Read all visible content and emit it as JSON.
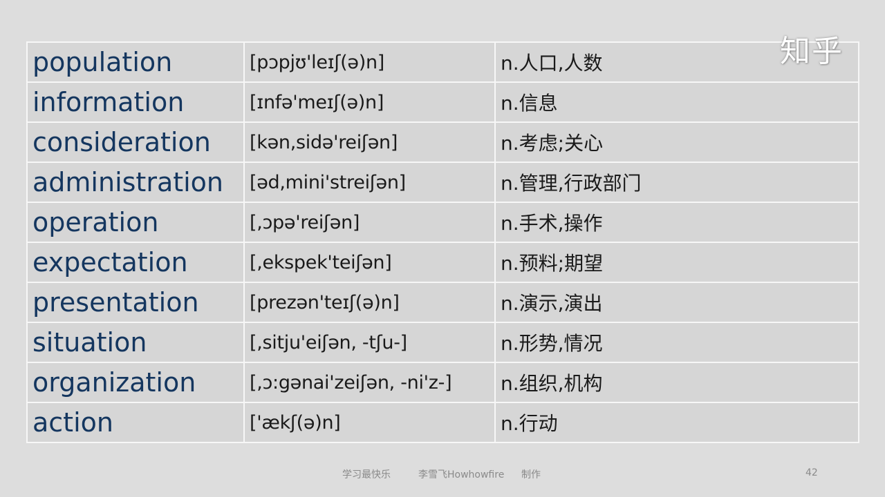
{
  "watermark": "知乎",
  "rows": [
    {
      "word": "population",
      "phonetic": "[pɔpjʊ'leɪʃ(ə)n]",
      "definition": "n.人口,人数"
    },
    {
      "word": "information",
      "phonetic": "[ɪnfə'meɪʃ(ə)n]",
      "definition": "n.信息"
    },
    {
      "word": "consideration",
      "phonetic": "[kən,sidə'reiʃən]",
      "definition": "n.考虑;关心"
    },
    {
      "word": "administration",
      "phonetic": "[əd,mini'streiʃən]",
      "definition": "n.管理,行政部门"
    },
    {
      "word": "operation",
      "phonetic": "[,ɔpə'reiʃən]",
      "definition": "n.手术,操作"
    },
    {
      "word": "expectation",
      "phonetic": "[,ekspek'teiʃən]",
      "definition": "n.预料;期望"
    },
    {
      "word": "presentation",
      "phonetic": "[prezən'teɪʃ(ə)n]",
      "definition": "n.演示,演出"
    },
    {
      "word": "situation",
      "phonetic": "[,sitju'eiʃən, -tʃu-]",
      "definition": "n.形势,情况"
    },
    {
      "word": "organization",
      "phonetic": "[,ɔ:gənai'zeiʃən, -ni'z-]",
      "definition": "n.组织,机构"
    },
    {
      "word": "action",
      "phonetic": "['ækʃ(ə)n]",
      "definition": "n.行动"
    }
  ],
  "footer": {
    "slogan": "学习最快乐",
    "credit": "李雪飞Howhowfire",
    "made_by": "制作",
    "page_number": "42"
  },
  "colors": {
    "word_text": "#14365f",
    "cell_background": "#d6d6d6",
    "cell_border": "#f7f7f7"
  }
}
